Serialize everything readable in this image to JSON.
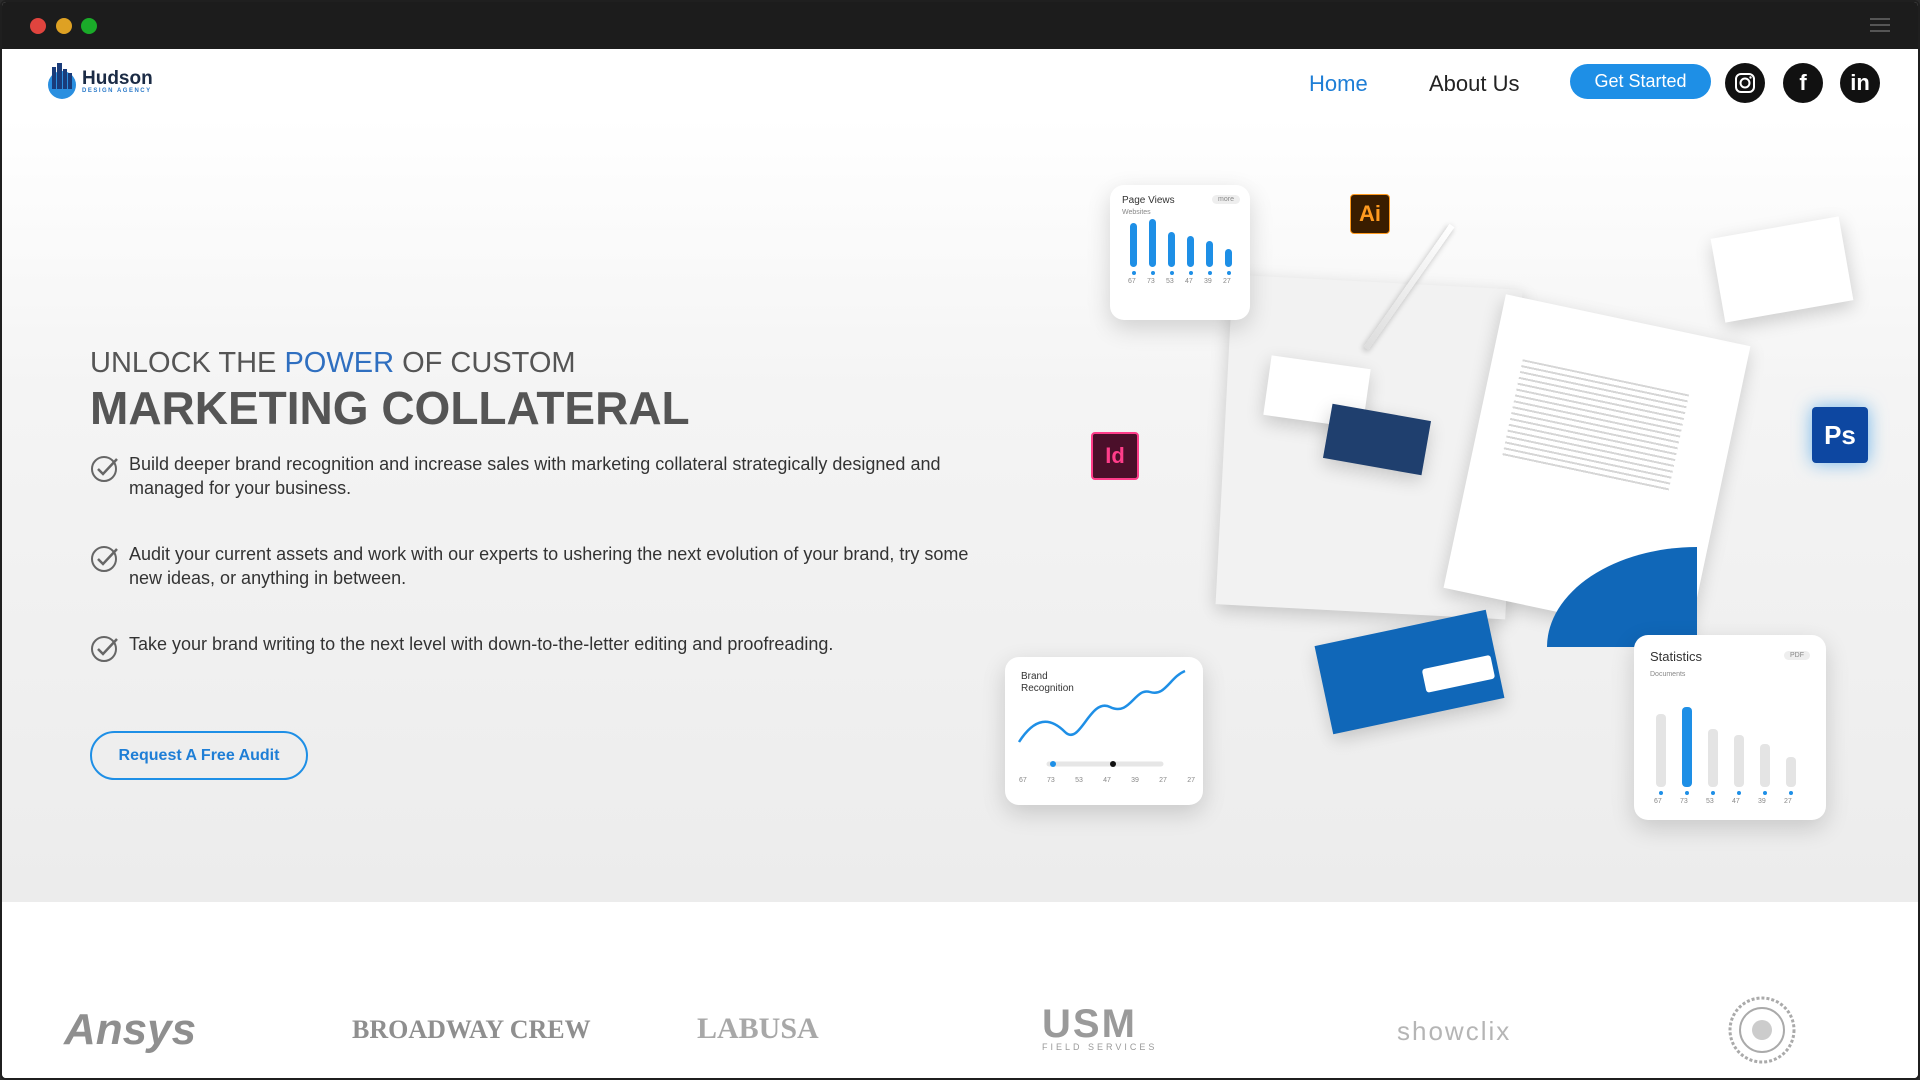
{
  "window": {
    "controls": [
      "close",
      "minimize",
      "maximize"
    ],
    "menu_icon": "hamburger-icon"
  },
  "header": {
    "logo": {
      "name": "Hudson",
      "tagline": "DESIGN AGENCY"
    },
    "nav": [
      {
        "label": "Home",
        "active": true
      },
      {
        "label": "About Us",
        "active": false
      }
    ],
    "cta_label": "Get Started",
    "social": [
      {
        "name": "instagram-icon",
        "glyph": "◎"
      },
      {
        "name": "facebook-icon",
        "glyph": "f"
      },
      {
        "name": "linkedin-icon",
        "glyph": "in"
      }
    ]
  },
  "hero": {
    "kicker_prefix": "UNLOCK THE ",
    "kicker_accent": "POWER",
    "kicker_suffix": " OF CUSTOM",
    "title": "MARKETING COLLATERAL",
    "bullets": [
      "Build deeper brand recognition and increase sales with marketing collateral strategically designed and managed for your business.",
      "Audit your current assets and work with our experts to ushering the next evolution of your brand, try some new ideas, or anything in between.",
      "Take your brand writing to the next level with down-to-the-letter editing and proofreading."
    ],
    "cta_label": "Request A Free Audit"
  },
  "illustration": {
    "page_views": {
      "title": "Page Views",
      "tag": "more",
      "subtitle": "Websites",
      "values": [
        67,
        73,
        53,
        47,
        39,
        27
      ]
    },
    "brand_recognition": {
      "title_line1": "Brand",
      "title_line2": "Recognition",
      "ticks": [
        67,
        73,
        53,
        47,
        39,
        27,
        27
      ]
    },
    "statistics": {
      "title": "Statistics",
      "tag": "PDF",
      "subtitle": "Documents",
      "values": [
        67,
        73,
        53,
        47,
        39,
        27
      ]
    },
    "app_icons": [
      {
        "label": "Ai",
        "name": "illustrator-icon"
      },
      {
        "label": "Id",
        "name": "indesign-icon"
      },
      {
        "label": "Ps",
        "name": "photoshop-icon"
      }
    ]
  },
  "clients": [
    "Ansys",
    "BROADWAY CREW",
    "LABUSA",
    "USM",
    "FIELD SERVICES",
    "showclix"
  ],
  "colors": {
    "accent": "#1e8fe6",
    "link_active": "#1e7ed6",
    "heading": "#555555",
    "title_bar": "#1c1c1c"
  }
}
